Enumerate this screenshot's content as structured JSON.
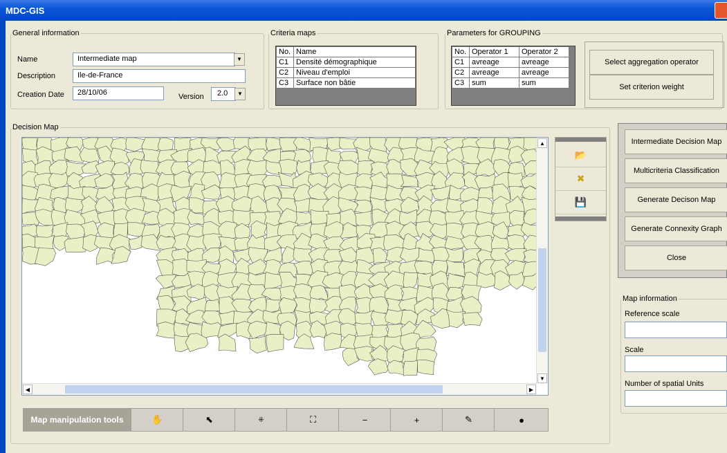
{
  "window": {
    "title": "MDC-GIS"
  },
  "general": {
    "legend": "General information",
    "name_label": "Name",
    "name_value": "Intermediate map",
    "description_label": "Description",
    "description_value": "Ile-de-France",
    "date_label": "Creation Date",
    "date_value": "28/10/06",
    "version_label": "Version",
    "version_value": "2.0"
  },
  "criteria": {
    "legend": "Criteria maps",
    "headers": [
      "No.",
      "Name"
    ],
    "rows": [
      [
        "C1",
        "Densité démographique"
      ],
      [
        "C2",
        "Niveau d'emploi"
      ],
      [
        "C3",
        "Surface non bâtie"
      ]
    ]
  },
  "grouping": {
    "legend": "Parameters for GROUPING",
    "headers": [
      "No.",
      "Operator 1",
      "Operator 2"
    ],
    "rows": [
      [
        "C1",
        "avreage",
        "avreage"
      ],
      [
        "C2",
        "avreage",
        "avreage"
      ],
      [
        "C3",
        "sum",
        "sum"
      ]
    ]
  },
  "actions": {
    "select_operator": "Select aggregation operator",
    "set_weight": "Set criterion weight"
  },
  "decision_map": {
    "legend": "Decision Map"
  },
  "side_tools": [
    "open-folder-icon",
    "delete-icon",
    "save-icon"
  ],
  "toolbar": {
    "label": "Map manipulation tools",
    "tools": [
      {
        "name": "pan-hand-icon",
        "glyph": "✋"
      },
      {
        "name": "select-arrow-icon",
        "glyph": "⬉"
      },
      {
        "name": "zoom-extent-in-icon",
        "glyph": "⁜"
      },
      {
        "name": "full-extent-icon",
        "glyph": "⛶"
      },
      {
        "name": "zoom-out-icon",
        "glyph": "🔍"
      },
      {
        "name": "zoom-in-icon",
        "glyph": "🔎"
      },
      {
        "name": "identify-icon",
        "glyph": "✎"
      },
      {
        "name": "globe-icon",
        "glyph": "🌐"
      }
    ]
  },
  "right_buttons": [
    "Intermediate Decision Map",
    "Multicriteria Classification",
    "Generate Decison Map",
    "Generate Connexity Graph",
    "Close"
  ],
  "map_info": {
    "legend": "Map information",
    "ref_scale_label": "Reference scale",
    "scale_label": "Scale",
    "units_label": "Number of spatial Units"
  },
  "colors": {
    "map_fill": "#e8f0c6",
    "map_stroke": "#555555",
    "title_bar": "#0a56d8"
  }
}
